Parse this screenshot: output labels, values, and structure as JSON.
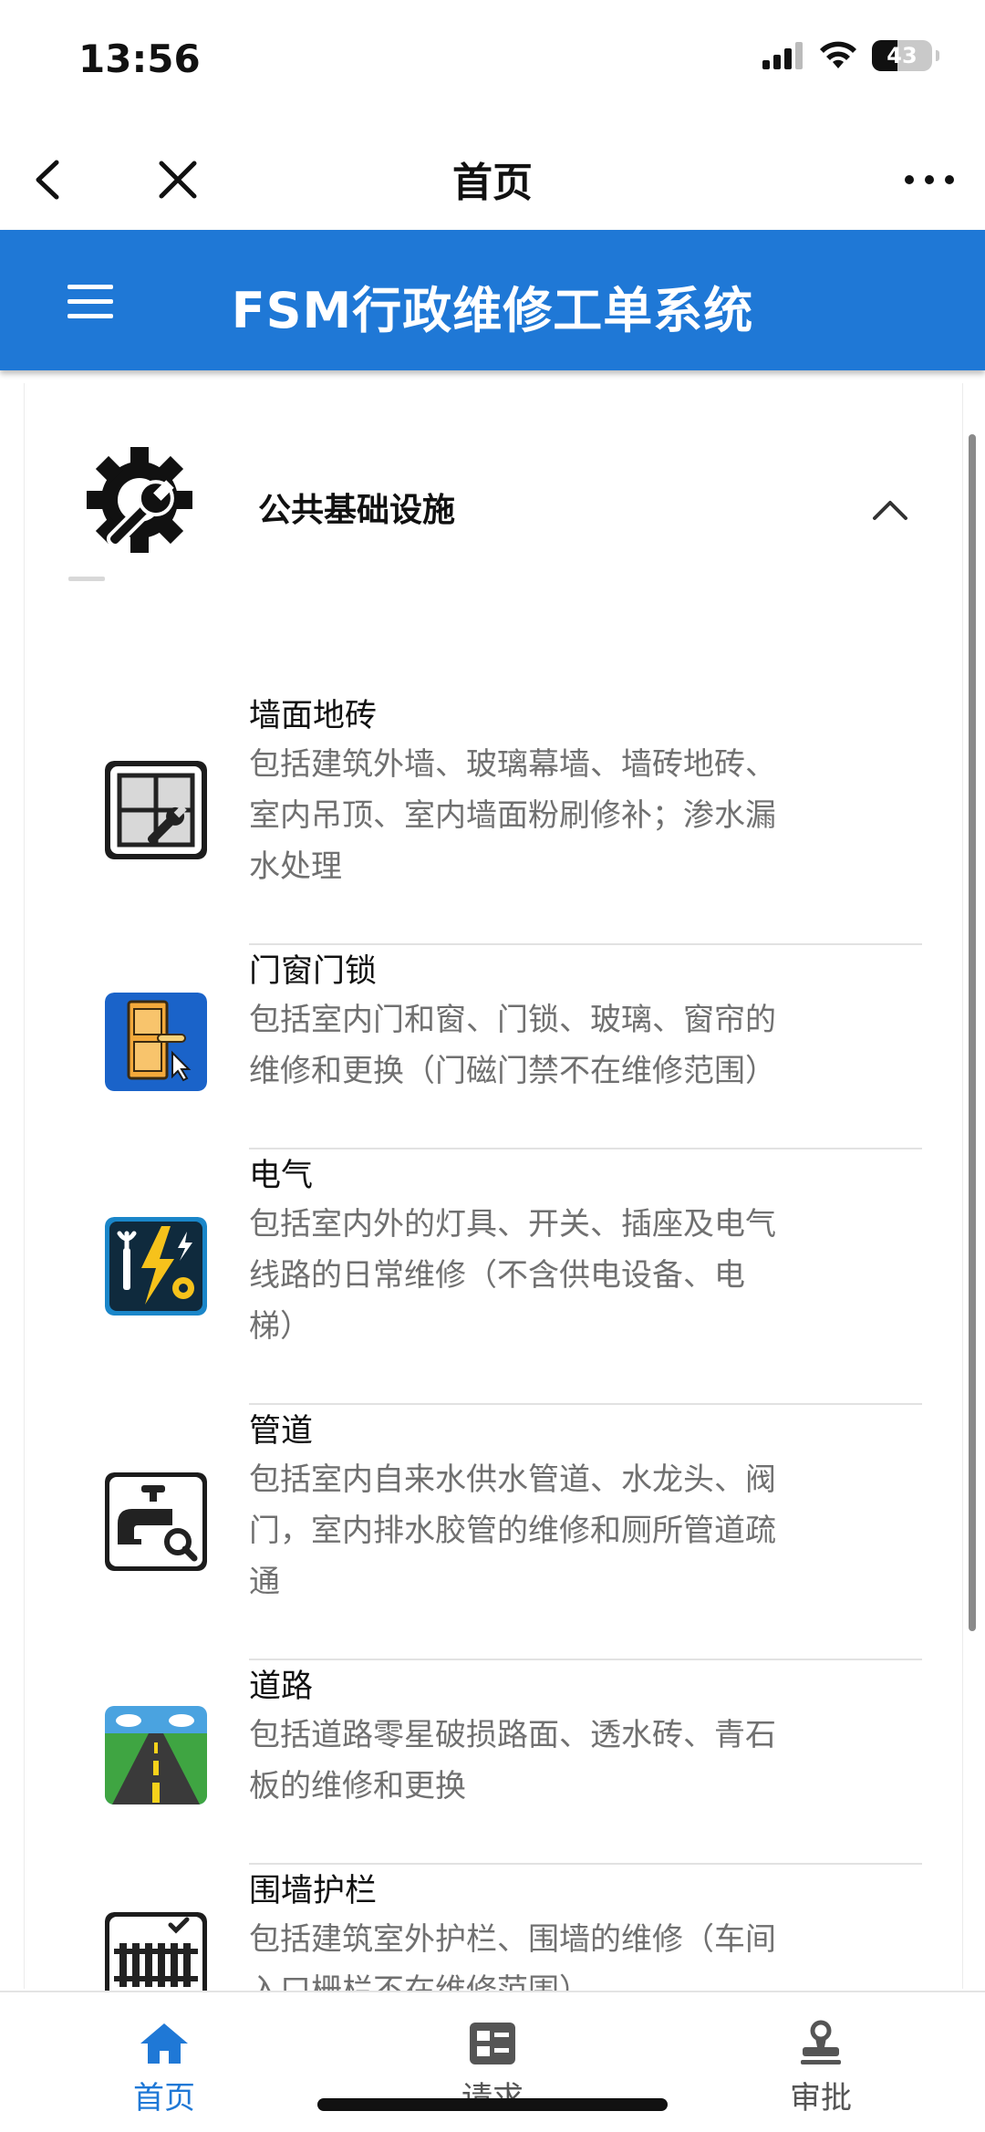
{
  "status_bar": {
    "time": "13:56",
    "battery": "43",
    "battery_level": 0.43
  },
  "nav": {
    "title": "首页"
  },
  "header": {
    "title": "FSM行政维修工单系统"
  },
  "section": {
    "title": "公共基础设施"
  },
  "items": [
    {
      "title": "墙面地砖",
      "desc_lines": [
        "包括建筑外墙、玻璃幕墙、墙砖地砖、",
        "室内吊顶、室内墙面粉刷修补；渗水漏",
        "水处理"
      ],
      "icon": "wall-tile-icon"
    },
    {
      "title": "门窗门锁",
      "desc_lines": [
        "包括室内门和窗、门锁、玻璃、窗帘的",
        "维修和更换（门磁门禁不在维修范围）"
      ],
      "icon": "door-lock-icon"
    },
    {
      "title": "电气",
      "desc_lines": [
        "包括室内外的灯具、开关、插座及电气",
        "线路的日常维修（不含供电设备、电",
        "梯）"
      ],
      "icon": "electric-icon"
    },
    {
      "title": "管道",
      "desc_lines": [
        "包括室内自来水供水管道、水龙头、阀",
        "门，室内排水胶管的维修和厕所管道疏",
        "通"
      ],
      "icon": "pipe-icon"
    },
    {
      "title": "道路",
      "desc_lines": [
        "包括道路零星破损路面、透水砖、青石",
        "板的维修和更换"
      ],
      "icon": "road-icon"
    },
    {
      "title": "围墙护栏",
      "desc_lines": [
        "包括建筑室外护栏、围墙的维修（车间",
        "入口栅栏不在维修范围）"
      ],
      "icon": "fence-icon"
    }
  ],
  "tabs": [
    {
      "label": "首页",
      "icon": "home-icon",
      "active": true
    },
    {
      "label": "请求",
      "icon": "request-icon",
      "active": false
    },
    {
      "label": "审批",
      "icon": "approve-icon",
      "active": false
    }
  ],
  "colors": {
    "brand": "#1f78d6",
    "desc_text": "#707070"
  }
}
